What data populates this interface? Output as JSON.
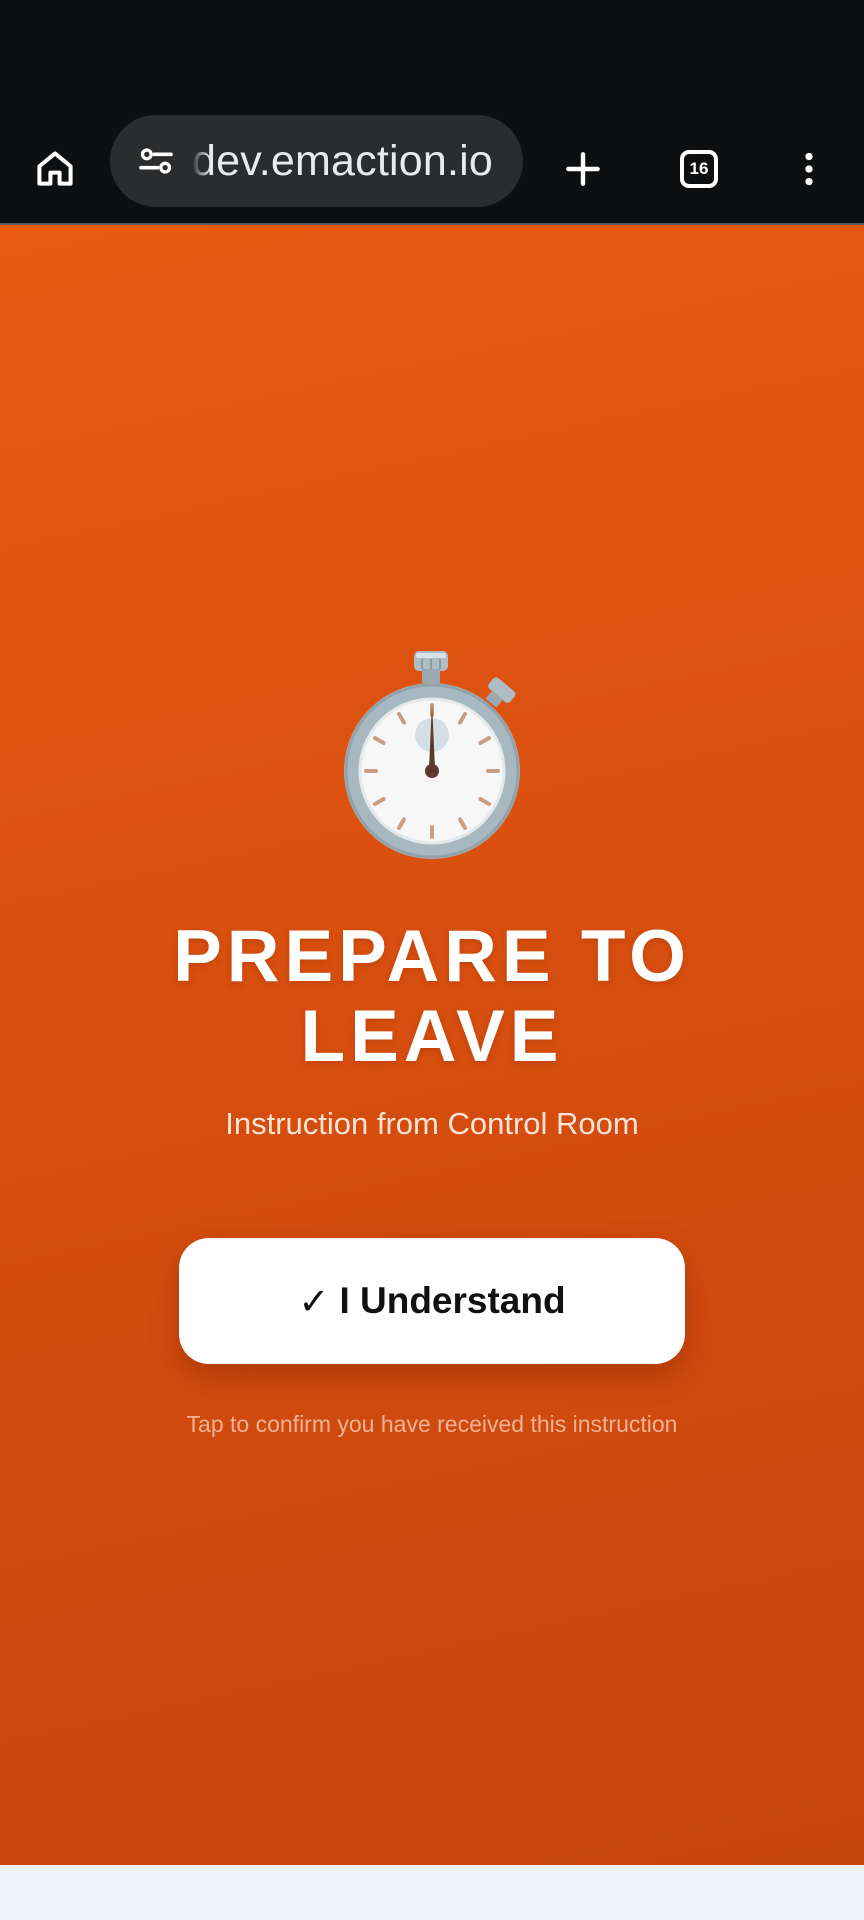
{
  "browser": {
    "url": "dev.emaction.io",
    "tab_count": "16",
    "icons": {
      "home": "home-icon",
      "site_settings": "tune-icon",
      "new_tab": "plus-icon",
      "tabs": "tab-switcher-icon",
      "menu": "more-vert-icon"
    }
  },
  "alert": {
    "icon": "stopwatch-icon",
    "headline_line1": "PREPARE TO",
    "headline_line2": "LEAVE",
    "subtitle": "Instruction from Control Room",
    "button_check": "✓",
    "button_label": "I Understand",
    "hint": "Tap to confirm you have received this instruction"
  },
  "colors": {
    "background_top": "#e95a10",
    "background_bottom": "#c6440e",
    "button_bg": "#ffffff",
    "chrome_bg": "#0e0f10"
  }
}
